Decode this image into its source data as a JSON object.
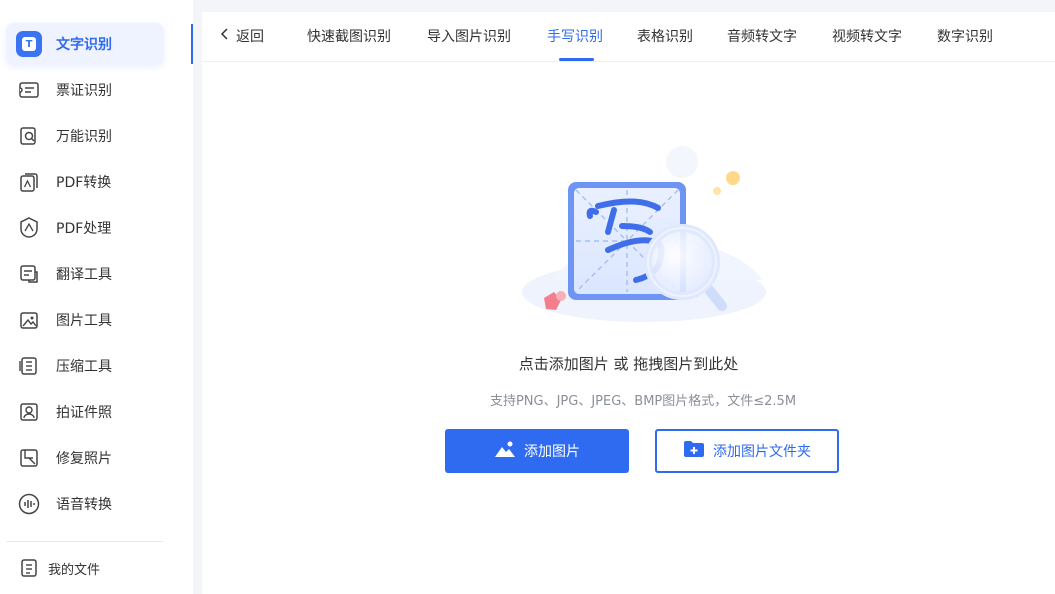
{
  "sidebar": {
    "items": [
      {
        "label": "文字识别",
        "icon": "text-recognition-icon",
        "active": true
      },
      {
        "label": "票证识别",
        "icon": "ticket-icon"
      },
      {
        "label": "万能识别",
        "icon": "universal-recognition-icon"
      },
      {
        "label": "PDF转换",
        "icon": "pdf-convert-icon"
      },
      {
        "label": "PDF处理",
        "icon": "pdf-process-icon"
      },
      {
        "label": "翻译工具",
        "icon": "translate-icon"
      },
      {
        "label": "图片工具",
        "icon": "image-tool-icon"
      },
      {
        "label": "压缩工具",
        "icon": "compress-icon"
      },
      {
        "label": "拍证件照",
        "icon": "id-photo-icon"
      },
      {
        "label": "修复照片",
        "icon": "photo-repair-icon"
      },
      {
        "label": "语音转换",
        "icon": "voice-convert-icon"
      }
    ],
    "my_files": "我的文件"
  },
  "header": {
    "back_label": "返回",
    "tabs": [
      {
        "label": "快速截图识别"
      },
      {
        "label": "导入图片识别"
      },
      {
        "label": "手写识别",
        "active": true
      },
      {
        "label": "表格识别"
      },
      {
        "label": "音频转文字"
      },
      {
        "label": "视频转文字"
      },
      {
        "label": "数字识别"
      }
    ]
  },
  "dropzone": {
    "title": "点击添加图片 或 拖拽图片到此处",
    "hint": "支持PNG、JPG、JPEG、BMP图片格式，文件≤2.5M",
    "add_image_label": "添加图片",
    "add_folder_label": "添加图片文件夹"
  },
  "colors": {
    "accent": "#2f6bf0",
    "sidebar_bg": "#ffffff",
    "page_bg": "#f3f5f9",
    "muted_text": "#8a8f99"
  }
}
